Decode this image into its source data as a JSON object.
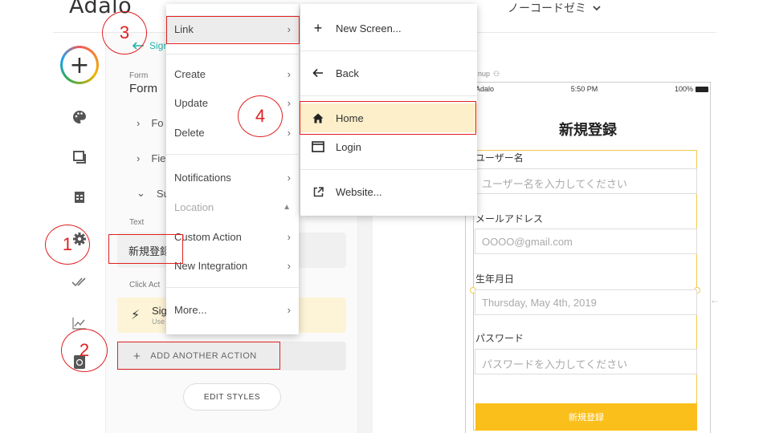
{
  "app": {
    "logo": "Adalo",
    "workspace": "ノーコードゼミ",
    "workspace_chevron": "chevron-down-icon"
  },
  "rail": {
    "add_label": "+",
    "icons": [
      "palette-icon",
      "screens-icon",
      "database-icon",
      "gear-icon",
      "publish-icon",
      "analytics-icon",
      "app-store-icon"
    ]
  },
  "panel": {
    "back_label": "Sign",
    "form_small": "Form",
    "form_name": "Form",
    "tree": [
      {
        "arrow": "›",
        "label": "Fo"
      },
      {
        "arrow": "›",
        "label": "Fie"
      },
      {
        "arrow": "⌄",
        "label": "Su"
      }
    ],
    "text_label": "Text",
    "text_value": "新規登録",
    "click_label": "Click Act",
    "action_title": "Sig",
    "action_sub": "Use",
    "add_action": "ADD ANOTHER ACTION",
    "edit_styles": "EDIT STYLES"
  },
  "menu": {
    "items": [
      {
        "label": "Link",
        "chevron": "›"
      },
      {
        "label": "Create",
        "chevron": "›"
      },
      {
        "label": "Update",
        "chevron": "›"
      },
      {
        "label": "Delete",
        "chevron": "›"
      },
      {
        "label": "Notifications",
        "chevron": "›"
      },
      {
        "label": "Location",
        "chevron": "▲"
      },
      {
        "label": "Custom Action",
        "chevron": "›"
      },
      {
        "label": "New Integration",
        "chevron": "›"
      },
      {
        "label": "More...",
        "chevron": "›"
      }
    ]
  },
  "submenu": {
    "items": [
      {
        "label": "New Screen...",
        "icon": "plus-icon"
      },
      {
        "label": "Back",
        "icon": "arrow-left-icon"
      },
      {
        "label": "Home",
        "icon": "home-icon"
      },
      {
        "label": "Login",
        "icon": "window-icon"
      },
      {
        "label": "Website...",
        "icon": "external-link-icon"
      }
    ]
  },
  "preview": {
    "screen_label": "nup",
    "carrier": "Adalo",
    "time": "5:50 PM",
    "battery": "100%",
    "title": "新規登録",
    "fields": [
      {
        "label": "ユーザー名",
        "placeholder": "ユーザー名を入力してください"
      },
      {
        "label": "メールアドレス",
        "placeholder": "OOOO@gmail.com"
      },
      {
        "label": "生年月日",
        "placeholder": "Thursday, May 4th, 2019"
      },
      {
        "label": "パスワード",
        "placeholder": "パスワードを入力してください"
      }
    ],
    "submit": "新規登録"
  },
  "annotations": {
    "one": "1",
    "two": "2",
    "three": "3",
    "four": "4",
    "color": "#e02020"
  },
  "colors": {
    "accent": "#20b2aa",
    "button": "#fbbf1b",
    "highlight": "#fcefc9"
  }
}
